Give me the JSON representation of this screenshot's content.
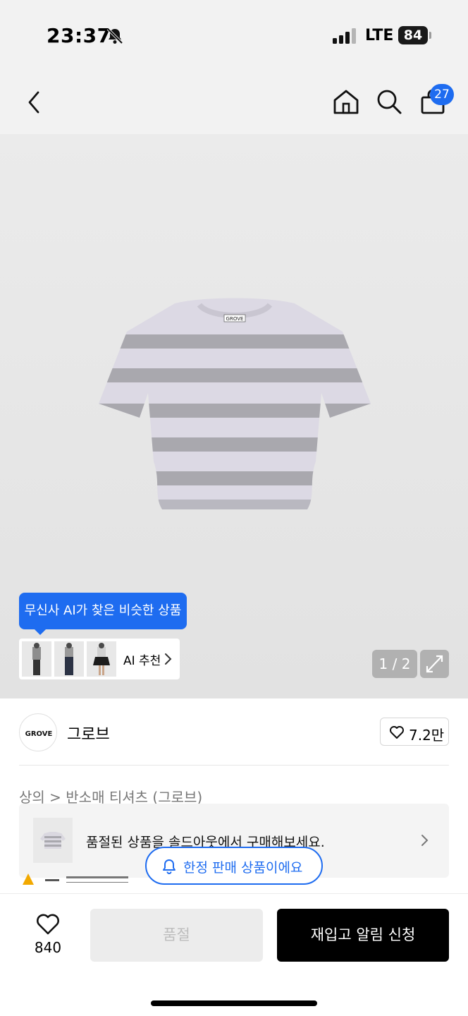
{
  "status_bar": {
    "time": "23:37",
    "network": "LTE",
    "battery": "84",
    "icons": [
      "bell-slash-icon",
      "signal-icon"
    ]
  },
  "nav": {
    "icons": [
      "back-chevron-icon",
      "home-icon",
      "search-icon",
      "bag-icon"
    ],
    "cart_badge": "27"
  },
  "gallery": {
    "image_logo": "GROVE",
    "ai_tooltip": "무신사 AI가 찾은 비슷한 상품",
    "ai_recommend_label": "AI 추천",
    "page_indicator": "1 / 2",
    "expand_icon": "expand-icon"
  },
  "brand": {
    "logo_text": "GROVE",
    "name": "그로브",
    "like_count": "7.2만"
  },
  "breadcrumb": {
    "text": "상의 > 반소매 티셔츠 (그로브)"
  },
  "soldout_banner": {
    "text": "품절된 상품을 솔드아웃에서 구매해보세요."
  },
  "limited": {
    "text": "한정 판매 상품이에요"
  },
  "bottom_bar": {
    "wish_count": "840",
    "soldout_label": "품절",
    "restock_label": "재입고 알림 신청"
  },
  "colors": {
    "accent": "#1e6cf0",
    "primary_button": "#000000",
    "disabled_button": "#ececec"
  }
}
